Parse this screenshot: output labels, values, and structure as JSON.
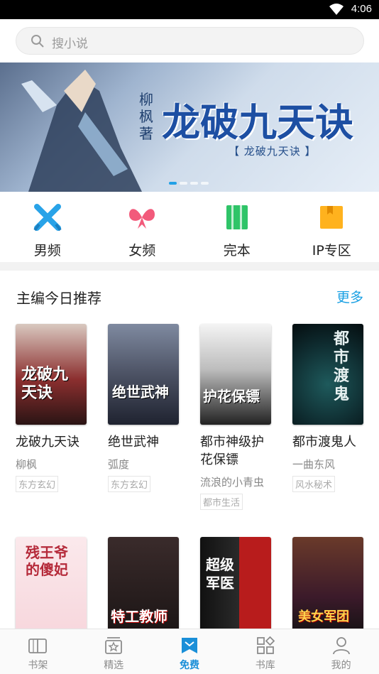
{
  "status_bar": {
    "time": "4:06"
  },
  "search": {
    "placeholder": "搜小说"
  },
  "banner": {
    "author": "柳枫著",
    "title": "龙破九天诀",
    "subtitle": "【 龙破九天诀 】"
  },
  "categories": [
    {
      "label": "男频",
      "icon": "male-channel-icon",
      "color": "#29a3e8"
    },
    {
      "label": "女频",
      "icon": "female-channel-icon",
      "color": "#f25a7b"
    },
    {
      "label": "完本",
      "icon": "completed-icon",
      "color": "#2fc468"
    },
    {
      "label": "IP专区",
      "icon": "ip-zone-icon",
      "color": "#ffb21e"
    }
  ],
  "section": {
    "title": "主编今日推荐",
    "more": "更多"
  },
  "books": [
    {
      "name": "龙破九天诀",
      "author": "柳枫",
      "tag": "东方玄幻",
      "cover_text": "龙破九天诀"
    },
    {
      "name": "绝世武神",
      "author": "弧度",
      "tag": "东方玄幻",
      "cover_text": "绝世武神"
    },
    {
      "name": "都市神级护花保镖",
      "author": "流浪的小青虫",
      "tag": "都市生活",
      "cover_text": "护花保镖"
    },
    {
      "name": "都市渡鬼人",
      "author": "一曲东风",
      "tag": "风水秘术",
      "cover_text": "都市渡鬼"
    }
  ],
  "books_row2": [
    {
      "cover_text": "残王爷的傻妃"
    },
    {
      "cover_text": "特工教师"
    },
    {
      "cover_text": "超级军医"
    },
    {
      "cover_text": "美女军团"
    }
  ],
  "tabs": [
    {
      "label": "书架",
      "icon": "bookshelf-icon"
    },
    {
      "label": "精选",
      "icon": "featured-icon"
    },
    {
      "label": "免费",
      "icon": "free-icon",
      "active": true
    },
    {
      "label": "书库",
      "icon": "library-icon"
    },
    {
      "label": "我的",
      "icon": "profile-icon"
    }
  ]
}
